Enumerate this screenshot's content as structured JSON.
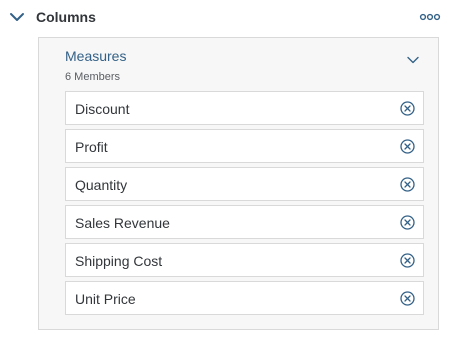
{
  "section": {
    "title": "Columns",
    "collapse_icon": "chevron-down-icon",
    "more_icon": "more-horizontal-icon"
  },
  "panel": {
    "title": "Measures",
    "subtitle": "6 Members",
    "expand_icon": "chevron-down-icon",
    "drag_icon": "vertical-grip-icon"
  },
  "members": [
    {
      "label": "Discount",
      "remove_icon": "remove-circle-icon"
    },
    {
      "label": "Profit",
      "remove_icon": "remove-circle-icon"
    },
    {
      "label": "Quantity",
      "remove_icon": "remove-circle-icon"
    },
    {
      "label": "Sales Revenue",
      "remove_icon": "remove-circle-icon"
    },
    {
      "label": "Shipping Cost",
      "remove_icon": "remove-circle-icon"
    },
    {
      "label": "Unit Price",
      "remove_icon": "remove-circle-icon"
    }
  ],
  "colors": {
    "accent": "#346187",
    "text": "#32363a",
    "subtext": "#5a5e63",
    "border": "#d9d9d9",
    "panel_bg": "#f7f7f7"
  }
}
